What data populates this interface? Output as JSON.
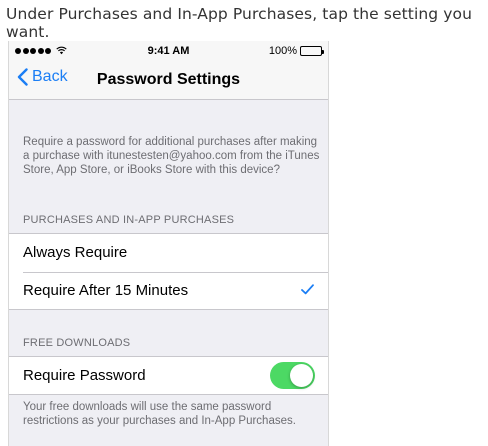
{
  "caption": "Under Purchases and In-App Purchases, tap the setting you want.",
  "status_bar": {
    "time": "9:41 AM",
    "battery": "100%",
    "signal_dots": 5,
    "icons": [
      "signal-dots-icon",
      "wifi-icon",
      "battery-icon"
    ]
  },
  "nav": {
    "back_label": "Back",
    "back_icon": "chevron-left-icon",
    "title": "Password Settings"
  },
  "description": "Require a password for additional purchases after making a purchase with itunestesten@yahoo.com from the iTunes Store, App Store, or iBooks Store with this device?",
  "purchases_section": {
    "header": "PURCHASES AND IN-APP PURCHASES",
    "options": [
      {
        "label": "Always Require",
        "selected": false
      },
      {
        "label": "Require After 15 Minutes",
        "selected": true
      }
    ]
  },
  "free_downloads_section": {
    "header": "FREE DOWNLOADS",
    "require_password_label": "Require Password",
    "require_password_on": true,
    "note": "Your free downloads will use the same password restrictions as your purchases and In-App Purchases."
  },
  "colors": {
    "accent": "#1b7ef5",
    "toggle_on": "#4cd964",
    "background": "#efeff4",
    "secondary_text": "#6d6d72"
  }
}
